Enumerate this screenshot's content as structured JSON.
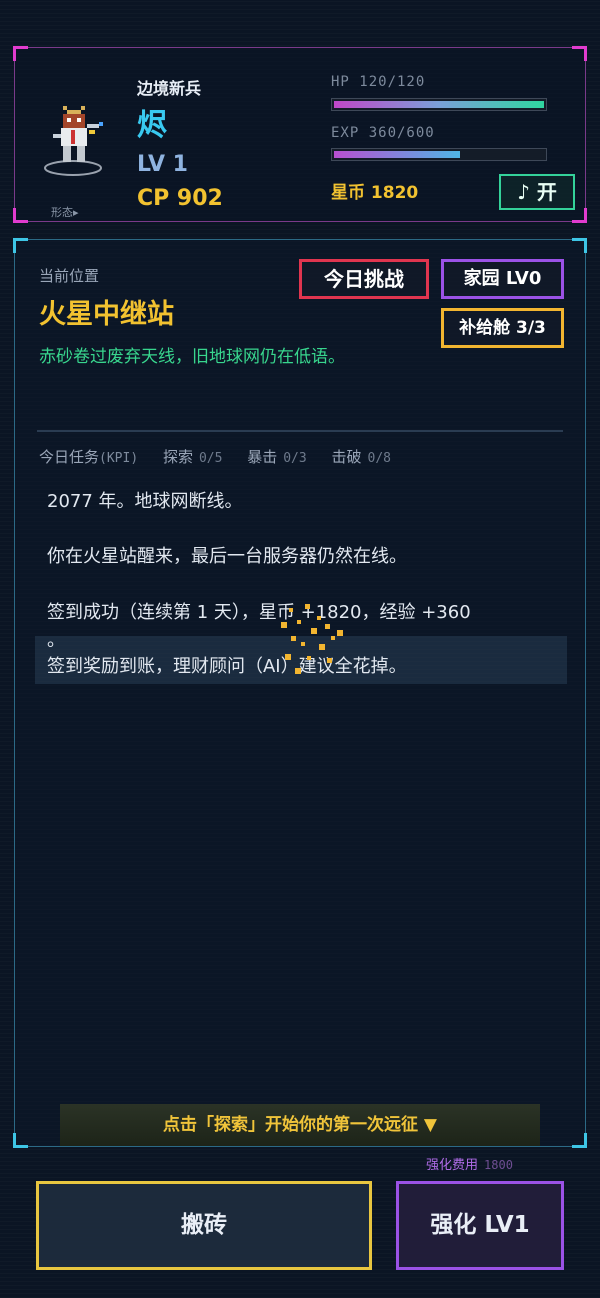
{
  "player": {
    "rank": "边境新兵",
    "name": "烬",
    "level": "LV 1",
    "cp": "CP 902",
    "form_label": "形态▸"
  },
  "stats": {
    "hp_label": "HP 120/120",
    "hp_fraction": 1.0,
    "exp_label": "EXP 360/600",
    "exp_fraction": 0.6,
    "coins": "星币 1820",
    "music_button": "♪ 开"
  },
  "location": {
    "label": "当前位置",
    "name": "火星中继站",
    "description": "赤砂卷过废弃天线，旧地球网仍在低语。"
  },
  "buttons": {
    "challenge": "今日挑战",
    "home": "家园 LV0",
    "supply": "补给舱 3/3"
  },
  "kpi": {
    "title": "今日任务",
    "title_suffix": "(KPI)",
    "explore_label": "探索",
    "explore_value": "0/5",
    "crit_label": "暴击",
    "crit_value": "0/3",
    "defeat_label": "击破",
    "defeat_value": "0/8"
  },
  "log": [
    "2077 年。地球网断线。",
    "你在火星站醒来，最后一台服务器仍然在线。",
    "签到成功（连续第 1 天），星币 +1820，经验 +360",
    "。",
    "签到奖励到账，理财顾问（AI）建议全花掉。"
  ],
  "hint": "点击「探索」开始你的第一次远征 ▼",
  "bottom": {
    "enhance_cost_label": "强化费用",
    "enhance_cost_value": "1800",
    "work_button": "搬砖",
    "enhance_button": "强化 LV1"
  },
  "colors": {
    "accent_magenta": "#e23ccf",
    "accent_cyan": "#3ec6e6",
    "gold": "#f2c230",
    "green": "#38d68e",
    "red": "#e0354f",
    "purple": "#9b52e6"
  }
}
